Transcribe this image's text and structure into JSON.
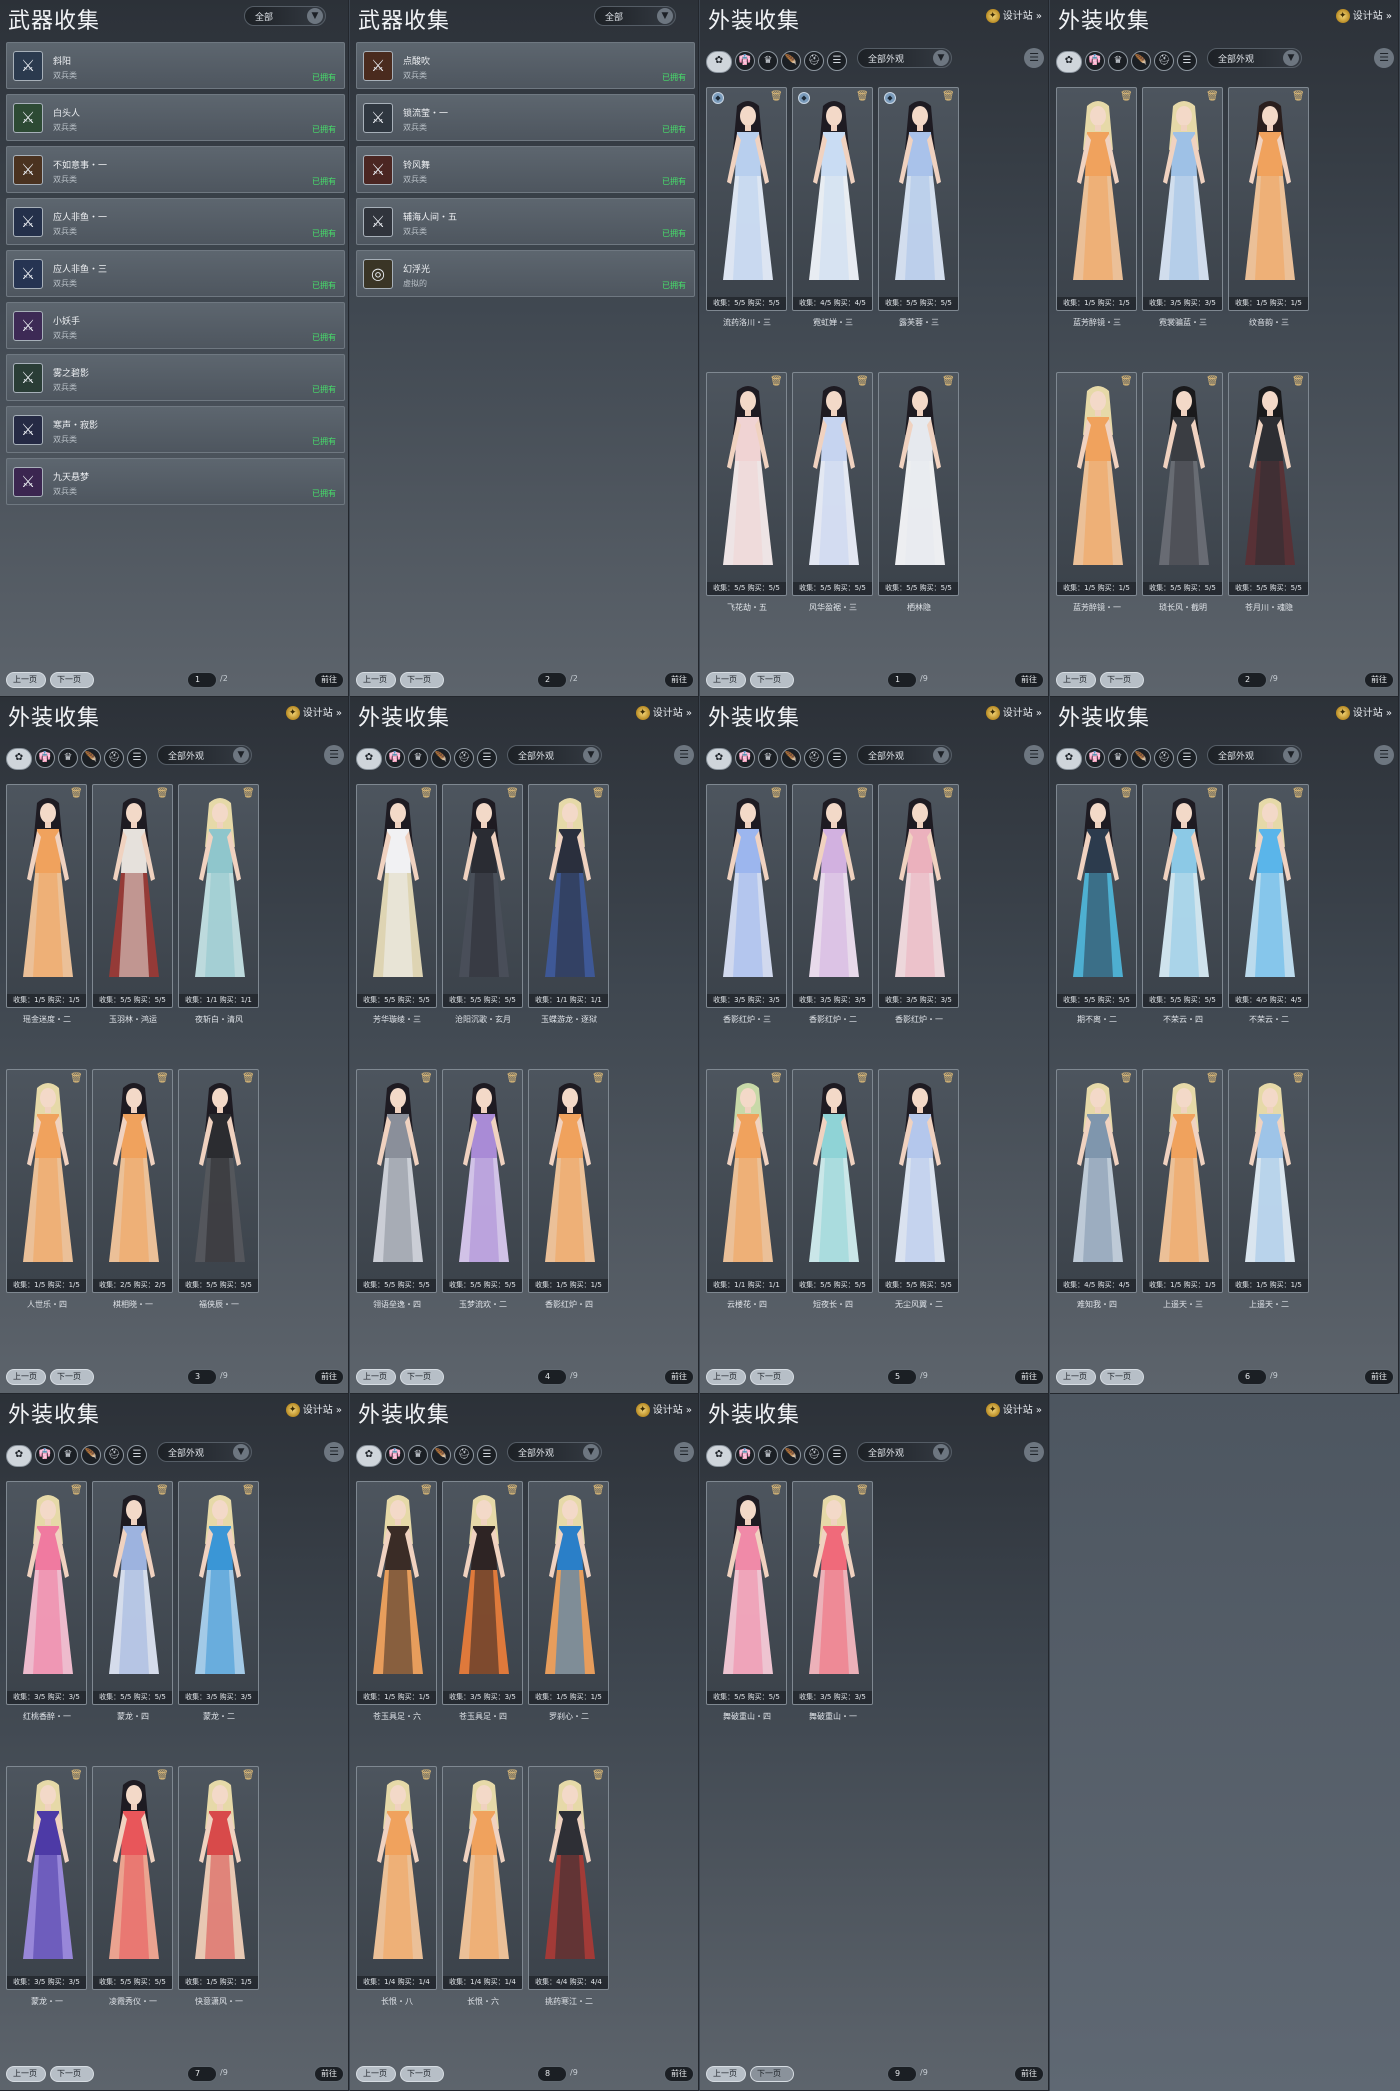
{
  "weapon_panels": [
    {
      "title": "武器收集",
      "filter": "全部",
      "items": [
        {
          "name": "斜阳",
          "type": "双兵类",
          "status": "已拥有",
          "color": "#2b3a4e",
          "glyph": "⚔"
        },
        {
          "name": "白头人",
          "type": "双兵类",
          "status": "已拥有",
          "color": "#2d4a34",
          "glyph": "⚔"
        },
        {
          "name": "不如意事・一",
          "type": "双兵类",
          "status": "已拥有",
          "color": "#4a3220",
          "glyph": "⚔"
        },
        {
          "name": "应人非鱼・一",
          "type": "双兵类",
          "status": "已拥有",
          "color": "#24304a",
          "glyph": "⚔"
        },
        {
          "name": "应人非鱼・三",
          "type": "双兵类",
          "status": "已拥有",
          "color": "#263452",
          "glyph": "⚔"
        },
        {
          "name": "小妖手",
          "type": "双兵类",
          "status": "已拥有",
          "color": "#3d2a55",
          "glyph": "⚔"
        },
        {
          "name": "雾之碧影",
          "type": "双兵类",
          "status": "已拥有",
          "color": "#2a3d36",
          "glyph": "⚔"
        },
        {
          "name": "寒声・寂影",
          "type": "双兵类",
          "status": "已拥有",
          "color": "#252a44",
          "glyph": "⚔"
        },
        {
          "name": "九天悬梦",
          "type": "双兵类",
          "status": "已拥有",
          "color": "#3b2650",
          "glyph": "⚔"
        }
      ],
      "page": "1",
      "total": "/2"
    },
    {
      "title": "武器收集",
      "filter": "全部",
      "items": [
        {
          "name": "点酸吹",
          "type": "双兵类",
          "status": "已拥有",
          "color": "#4a2b1e",
          "glyph": "⚔"
        },
        {
          "name": "锁流莹・一",
          "type": "双兵类",
          "status": "已拥有",
          "color": "#2f3740",
          "glyph": "⚔"
        },
        {
          "name": "铃风舞",
          "type": "双兵类",
          "status": "已拥有",
          "color": "#4b2622",
          "glyph": "⚔"
        },
        {
          "name": "辅海人间・五",
          "type": "双兵类",
          "status": "已拥有",
          "color": "#30343c",
          "glyph": "⚔"
        },
        {
          "name": "幻浮光",
          "type": "虚拟的",
          "status": "已拥有",
          "color": "#3a3526",
          "glyph": "◎"
        }
      ],
      "page": "2",
      "total": "/2"
    }
  ],
  "outfit_panels": [
    {
      "title": "外装收集",
      "designer": "设计站",
      "filter": "全部外观",
      "page": "1",
      "total": "/9",
      "cards": [
        {
          "name": "流药洛川・三",
          "stats": "收集：5/5   购买：5/5",
          "c1": "#b8cfee",
          "c2": "#e6eefb",
          "hair": "#1e1b22",
          "badge": true
        },
        {
          "name": "霓虹婵・三",
          "stats": "收集：4/5   购买：4/5",
          "c1": "#c9dcf3",
          "c2": "#f1f5fb",
          "hair": "#1e1b22",
          "badge": true
        },
        {
          "name": "露芙蓉・三",
          "stats": "收集：5/5   购买：5/5",
          "c1": "#a9c2ea",
          "c2": "#dbe7f7",
          "hair": "#1e1b22",
          "badge": true
        },
        {
          "name": "飞花劫・五",
          "stats": "收集：5/5   购买：5/5",
          "c1": "#f0d3d3",
          "c2": "#f8eded",
          "hair": "#1e1b22",
          "badge": false
        },
        {
          "name": "风华盈裾・三",
          "stats": "收集：5/5   购买：5/5",
          "c1": "#c6d4f0",
          "c2": "#ecf0fb",
          "hair": "#1e1b22",
          "badge": false
        },
        {
          "name": "栖林隐",
          "stats": "收集：5/5   购买：5/5",
          "c1": "#e6e9ee",
          "c2": "#f7f8fa",
          "hair": "#1e1b22",
          "badge": false
        }
      ]
    },
    {
      "title": "外装收集",
      "designer": "设计站",
      "filter": "全部外观",
      "page": "2",
      "total": "/9",
      "cards": [
        {
          "name": "蓝芳醉镜・三",
          "stats": "收集：1/5   购买：1/5",
          "c1": "#f0a25d",
          "c2": "#f4c79c",
          "hair": "#e6d9a8",
          "badge": false
        },
        {
          "name": "霓裳骗蓝・三",
          "stats": "收集：3/5   购买：3/5",
          "c1": "#9ec1e6",
          "c2": "#d9e6f5",
          "hair": "#e6d9a8",
          "badge": false
        },
        {
          "name": "纹音韵・三",
          "stats": "收集：1/5   购买：1/5",
          "c1": "#f0a25d",
          "c2": "#f4c79c",
          "hair": "#2a1f1e",
          "badge": false
        },
        {
          "name": "蓝芳醉镜・一",
          "stats": "收集：1/5   购买：1/5",
          "c1": "#f0a25d",
          "c2": "#f4c79c",
          "hair": "#e6d9a8",
          "badge": false
        },
        {
          "name": "琐长风・截明",
          "stats": "收集：5/5   购买：5/5",
          "c1": "#3a3d42",
          "c2": "#6a6e75",
          "hair": "#1a1a1c",
          "badge": false
        },
        {
          "name": "苍月川・魂隐",
          "stats": "收集：5/5   购买：5/5",
          "c1": "#2d2e33",
          "c2": "#5a3035",
          "hair": "#1a1a1c",
          "badge": false
        }
      ]
    },
    {
      "title": "外装收集",
      "designer": "设计站",
      "filter": "全部外观",
      "page": "3",
      "total": "/9",
      "cards": [
        {
          "name": "瑶金迷度・二",
          "stats": "收集：1/5   购买：1/5",
          "c1": "#f0a25d",
          "c2": "#f4c79c",
          "hair": "#1e1b22",
          "badge": false
        },
        {
          "name": "玉羽林・鸿运",
          "stats": "收集：5/5   购买：5/5",
          "c1": "#e6e1dc",
          "c2": "#9a3a36",
          "hair": "#1e1b22",
          "badge": false
        },
        {
          "name": "夜斩白・清风",
          "stats": "收集：1/1   购买：1/1",
          "c1": "#8fc6cc",
          "c2": "#c4e3e5",
          "hair": "#e6d9a8",
          "badge": false
        },
        {
          "name": "人世乐・四",
          "stats": "收集：1/5   购买：1/5",
          "c1": "#f0a25d",
          "c2": "#f4c79c",
          "hair": "#e6d9a8",
          "badge": false
        },
        {
          "name": "棋相晓・一",
          "stats": "收集：2/5   购买：2/5",
          "c1": "#f0a25d",
          "c2": "#f4c79c",
          "hair": "#1e1b22",
          "badge": false
        },
        {
          "name": "福侠辰・一",
          "stats": "收集：5/5   购买：5/5",
          "c1": "#2b2c30",
          "c2": "#55575d",
          "hair": "#1e1b22",
          "badge": false
        }
      ]
    },
    {
      "title": "外装收集",
      "designer": "设计站",
      "filter": "全部外观",
      "page": "4",
      "total": "/9",
      "cards": [
        {
          "name": "芳华璇绫・三",
          "stats": "收集：5/5   购买：5/5",
          "c1": "#f1f1f3",
          "c2": "#e7dcb8",
          "hair": "#1e1b22",
          "badge": false
        },
        {
          "name": "沧阳沉歌・玄月",
          "stats": "收集：5/5   购买：5/5",
          "c1": "#2a2c33",
          "c2": "#4a4f5a",
          "hair": "#1e1b22",
          "badge": false
        },
        {
          "name": "玉蝶游龙・逐狱",
          "stats": "收集：1/1   购买：1/1",
          "c1": "#2a2f3d",
          "c2": "#3e5a9a",
          "hair": "#e6d9a8",
          "badge": false
        },
        {
          "name": "翎语垒逸・四",
          "stats": "收集：5/5   购买：5/5",
          "c1": "#8a8f9a",
          "c2": "#d3d6dd",
          "hair": "#1e1b22",
          "badge": false
        },
        {
          "name": "玉梦流欢・二",
          "stats": "收集：5/5   购买：5/5",
          "c1": "#a98bd6",
          "c2": "#d9c9ef",
          "hair": "#1e1b22",
          "badge": false
        },
        {
          "name": "香影红炉・四",
          "stats": "收集：1/5   购买：1/5",
          "c1": "#f0a25d",
          "c2": "#f4c79c",
          "hair": "#1e1b22",
          "badge": false
        }
      ]
    },
    {
      "title": "外装收集",
      "designer": "设计站",
      "filter": "全部外观",
      "page": "5",
      "total": "/9",
      "cards": [
        {
          "name": "香影红炉・三",
          "stats": "收集：3/5   购买：3/5",
          "c1": "#9cb6ee",
          "c2": "#d9e2f7",
          "hair": "#1e1b22",
          "badge": false
        },
        {
          "name": "香影红炉・二",
          "stats": "收集：3/5   购买：3/5",
          "c1": "#d2b1e0",
          "c2": "#f1e3f3",
          "hair": "#1e1b22",
          "badge": false
        },
        {
          "name": "香影红炉・一",
          "stats": "收集：3/5   购买：3/5",
          "c1": "#ebb1bd",
          "c2": "#f7dfe3",
          "hair": "#1e1b22",
          "badge": false
        },
        {
          "name": "云楼花・四",
          "stats": "收集：1/1   购买：1/1",
          "c1": "#f0a25d",
          "c2": "#f4c79c",
          "hair": "#c8d9a8",
          "badge": false
        },
        {
          "name": "短夜长・四",
          "stats": "收集：5/5   购买：5/5",
          "c1": "#8fd3d6",
          "c2": "#d2eff0",
          "hair": "#1e1b22",
          "badge": false
        },
        {
          "name": "无尘风翼・二",
          "stats": "收集：5/5   购买：5/5",
          "c1": "#b4c7ec",
          "c2": "#e3ebf8",
          "hair": "#1e1b22",
          "badge": false
        }
      ]
    },
    {
      "title": "外装收集",
      "designer": "设计站",
      "filter": "全部外观",
      "page": "6",
      "total": "/9",
      "cards": [
        {
          "name": "期不离・二",
          "stats": "收集：5/5   购买：5/5",
          "c1": "#2c3b4d",
          "c2": "#4fb5d8",
          "hair": "#1e1b22",
          "badge": false
        },
        {
          "name": "不荣云・四",
          "stats": "收集：5/5   购买：5/5",
          "c1": "#8cc9e6",
          "c2": "#d7ecf6",
          "hair": "#1e1b22",
          "badge": false
        },
        {
          "name": "不荣云・二",
          "stats": "收集：4/5   购买：4/5",
          "c1": "#5ab5ea",
          "c2": "#c3e4f6",
          "hair": "#e6d9a8",
          "badge": false
        },
        {
          "name": "难知我・四",
          "stats": "收集：4/5   购买：4/5",
          "c1": "#7f96ad",
          "c2": "#c5d2de",
          "hair": "#e6d9a8",
          "badge": false
        },
        {
          "name": "上遥天・三",
          "stats": "收集：1/5   购买：1/5",
          "c1": "#f0a25d",
          "c2": "#f4c79c",
          "hair": "#e6d9a8",
          "badge": false
        },
        {
          "name": "上遥天・二",
          "stats": "收集：1/5   购买：1/5",
          "c1": "#9ec4e8",
          "c2": "#e3eef8",
          "hair": "#e6d9a8",
          "badge": false
        }
      ]
    },
    {
      "title": "外装收集",
      "designer": "设计站",
      "filter": "全部外观",
      "page": "7",
      "total": "/9",
      "cards": [
        {
          "name": "红桃香醉・一",
          "stats": "收集：3/5   购买：3/5",
          "c1": "#f07aa0",
          "c2": "#f8c2d4",
          "hair": "#e6d9a8",
          "badge": false
        },
        {
          "name": "蒙龙・四",
          "stats": "收集：5/5   购买：5/5",
          "c1": "#9db3df",
          "c2": "#dde5f3",
          "hair": "#1e1b22",
          "badge": false
        },
        {
          "name": "蒙龙・二",
          "stats": "收集：3/5   购买：3/5",
          "c1": "#3a96d6",
          "c2": "#a9d2ef",
          "hair": "#e6d9a8",
          "badge": false
        },
        {
          "name": "蒙龙・一",
          "stats": "收集：3/5   购买：3/5",
          "c1": "#4d3aa6",
          "c2": "#9d8be0",
          "hair": "#e6d9a8",
          "badge": false
        },
        {
          "name": "凌霞秀仪・一",
          "stats": "收集：5/5   购买：5/5",
          "c1": "#e8565a",
          "c2": "#f4a994",
          "hair": "#1e1b22",
          "badge": false
        },
        {
          "name": "快意潇风・一",
          "stats": "收集：1/5   购买：1/5",
          "c1": "#d84a4a",
          "c2": "#f1d0b8",
          "hair": "#e6d9a8",
          "badge": false
        }
      ]
    },
    {
      "title": "外装收集",
      "designer": "设计站",
      "filter": "全部外观",
      "page": "8",
      "total": "/9",
      "cards": [
        {
          "name": "苍玉具足・六",
          "stats": "收集：1/5   购买：1/5",
          "c1": "#3a2c26",
          "c2": "#f0a25d",
          "hair": "#e6d9a8",
          "badge": false
        },
        {
          "name": "苍玉具足・四",
          "stats": "收集：3/5   购买：3/5",
          "c1": "#2e2424",
          "c2": "#e87c3a",
          "hair": "#e6d9a8",
          "badge": false
        },
        {
          "name": "罗刹心・二",
          "stats": "收集：1/5   购买：1/5",
          "c1": "#2a7fc8",
          "c2": "#f0a25d",
          "hair": "#e6d9a8",
          "badge": false
        },
        {
          "name": "长恨・八",
          "stats": "收集：1/4   购买：1/4",
          "c1": "#f0a25d",
          "c2": "#f4c79c",
          "hair": "#e6d9a8",
          "badge": false
        },
        {
          "name": "长恨・六",
          "stats": "收集：1/4   购买：1/4",
          "c1": "#f0a25d",
          "c2": "#f4c79c",
          "hair": "#e6d9a8",
          "badge": false
        },
        {
          "name": "挑药寒江・二",
          "stats": "收集：4/4   购买：4/4",
          "c1": "#2e2f35",
          "c2": "#a83a36",
          "hair": "#e6d9a8",
          "badge": false
        }
      ]
    },
    {
      "title": "外装收集",
      "designer": "设计站",
      "filter": "全部外观",
      "page": "9",
      "total": "/9",
      "cards": [
        {
          "name": "舞破重山・四",
          "stats": "收集：5/5   购买：5/5",
          "c1": "#f08aa8",
          "c2": "#f8cbd8",
          "hair": "#1e1b22",
          "badge": false
        },
        {
          "name": "舞破重山・一",
          "stats": "收集：3/5   购买：3/5",
          "c1": "#f06a7a",
          "c2": "#f6b7bf",
          "hair": "#e6d9a8",
          "badge": false
        }
      ]
    }
  ],
  "pager": {
    "prev": "上一页",
    "next": "下一页",
    "jump": "前往"
  }
}
